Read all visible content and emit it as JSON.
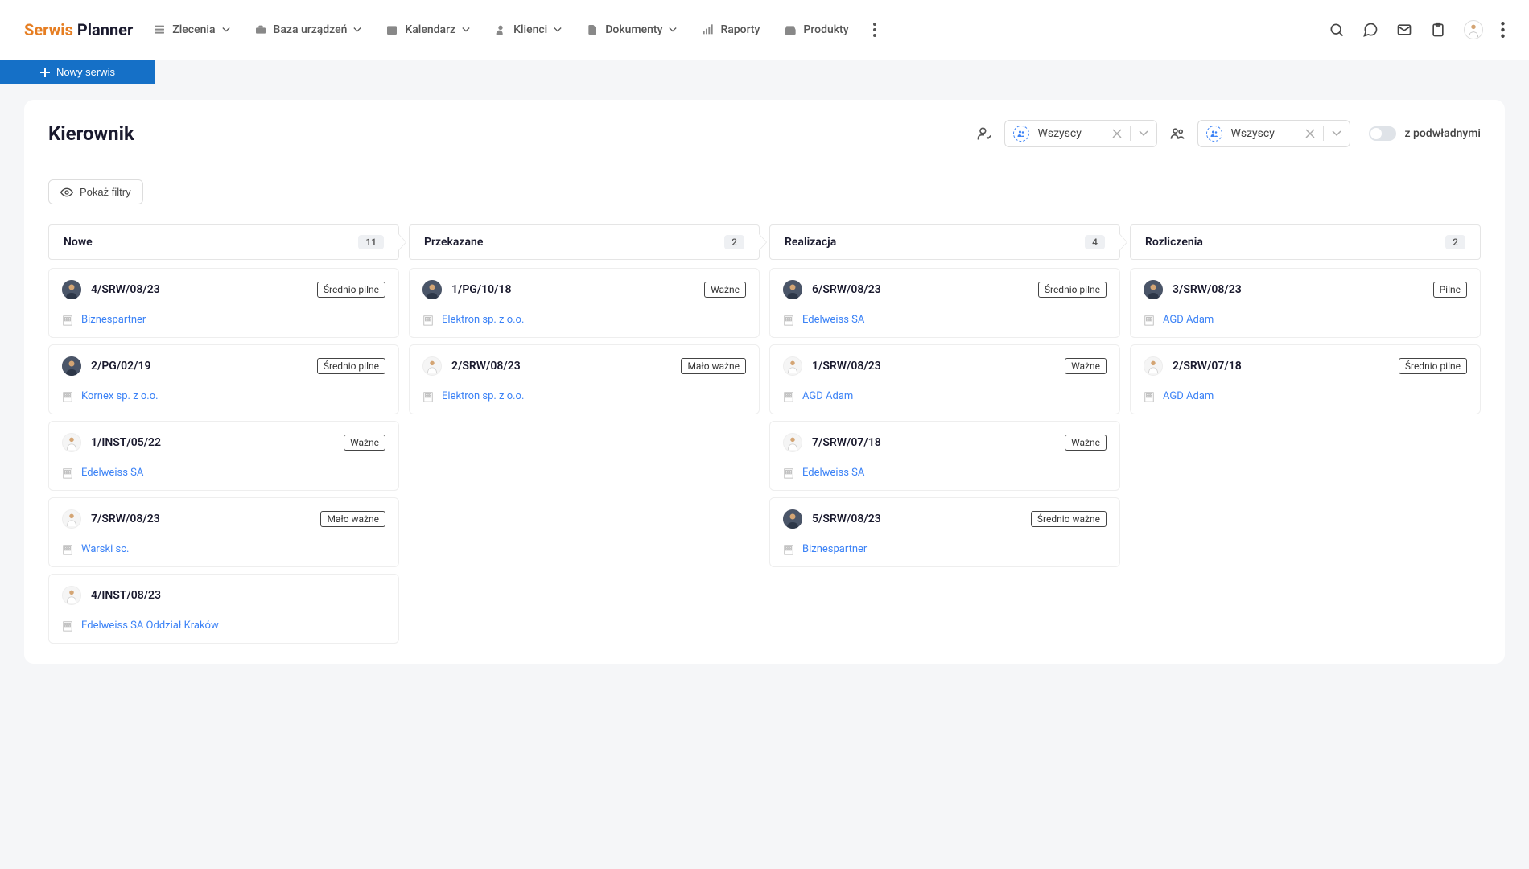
{
  "logo": {
    "part1": "Serwis",
    "part2": "Planner"
  },
  "nav": [
    {
      "label": "Zlecenia",
      "icon": "list",
      "chevron": true
    },
    {
      "label": "Baza urządzeń",
      "icon": "toolbox",
      "chevron": true
    },
    {
      "label": "Kalendarz",
      "icon": "calendar",
      "chevron": true
    },
    {
      "label": "Klienci",
      "icon": "person",
      "chevron": true
    },
    {
      "label": "Dokumenty",
      "icon": "document",
      "chevron": true
    },
    {
      "label": "Raporty",
      "icon": "bars",
      "chevron": false
    },
    {
      "label": "Produkty",
      "icon": "inbox",
      "chevron": false
    }
  ],
  "new_service_button": "Nowy serwis",
  "manager": {
    "title": "Kierownik",
    "select1": "Wszyscy",
    "select2": "Wszyscy",
    "toggle_label": "z podwładnymi"
  },
  "filters_button": "Pokaż filtry",
  "columns": [
    {
      "title": "Nowe",
      "count": "11",
      "cards": [
        {
          "id": "4/SRW/08/23",
          "tag": "Średnio pilne",
          "client": "Biznespartner",
          "avatar": "dark"
        },
        {
          "id": "2/PG/02/19",
          "tag": "Średnio pilne",
          "client": "Kornex sp. z o.o.",
          "avatar": "dark"
        },
        {
          "id": "1/INST/05/22",
          "tag": "Ważne",
          "client": "Edelweiss SA",
          "avatar": "light"
        },
        {
          "id": "7/SRW/08/23",
          "tag": "Mało ważne",
          "client": "Warski sc.",
          "avatar": "light"
        },
        {
          "id": "4/INST/08/23",
          "tag": "",
          "client": "Edelweiss SA Oddział Kraków",
          "avatar": "light"
        }
      ]
    },
    {
      "title": "Przekazane",
      "count": "2",
      "cards": [
        {
          "id": "1/PG/10/18",
          "tag": "Ważne",
          "client": "Elektron sp. z o.o.",
          "avatar": "dark"
        },
        {
          "id": "2/SRW/08/23",
          "tag": "Mało ważne",
          "client": "Elektron sp. z o.o.",
          "avatar": "light"
        }
      ]
    },
    {
      "title": "Realizacja",
      "count": "4",
      "cards": [
        {
          "id": "6/SRW/08/23",
          "tag": "Średnio pilne",
          "client": "Edelweiss SA",
          "avatar": "dark"
        },
        {
          "id": "1/SRW/08/23",
          "tag": "Ważne",
          "client": "AGD Adam",
          "avatar": "light"
        },
        {
          "id": "7/SRW/07/18",
          "tag": "Ważne",
          "client": "Edelweiss SA",
          "avatar": "light"
        },
        {
          "id": "5/SRW/08/23",
          "tag": "Średnio ważne",
          "client": "Biznespartner",
          "avatar": "dark"
        }
      ]
    },
    {
      "title": "Rozliczenia",
      "count": "2",
      "cards": [
        {
          "id": "3/SRW/08/23",
          "tag": "Pilne",
          "client": "AGD Adam",
          "avatar": "dark"
        },
        {
          "id": "2/SRW/07/18",
          "tag": "Średnio pilne",
          "client": "AGD Adam",
          "avatar": "light"
        }
      ]
    }
  ]
}
